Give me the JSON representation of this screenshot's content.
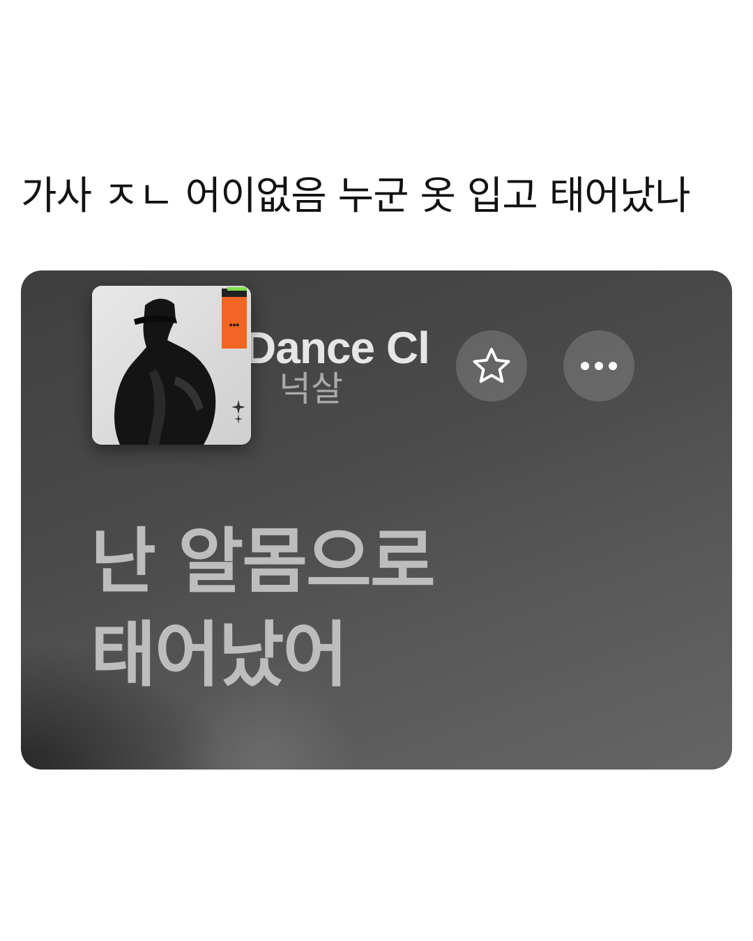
{
  "caption": "가사 ㅈㄴ 어이없음 누군 옷 입고 태어났나",
  "player": {
    "song_title": "Dance Cl",
    "artist": "넉살",
    "album_art": "album-cover-hooded-figure",
    "buttons": {
      "favorite_icon": "star-outline-icon",
      "more_icon": "ellipsis-icon"
    },
    "lyrics": [
      "난 알몸으로",
      "태어났어"
    ]
  },
  "colors": {
    "card_background": "#4a4a4a",
    "lyrics_text": "#bdbdbd",
    "title_text": "#e6e6e6",
    "artist_text": "#a9a9a9",
    "album_accent": "#f26522"
  }
}
